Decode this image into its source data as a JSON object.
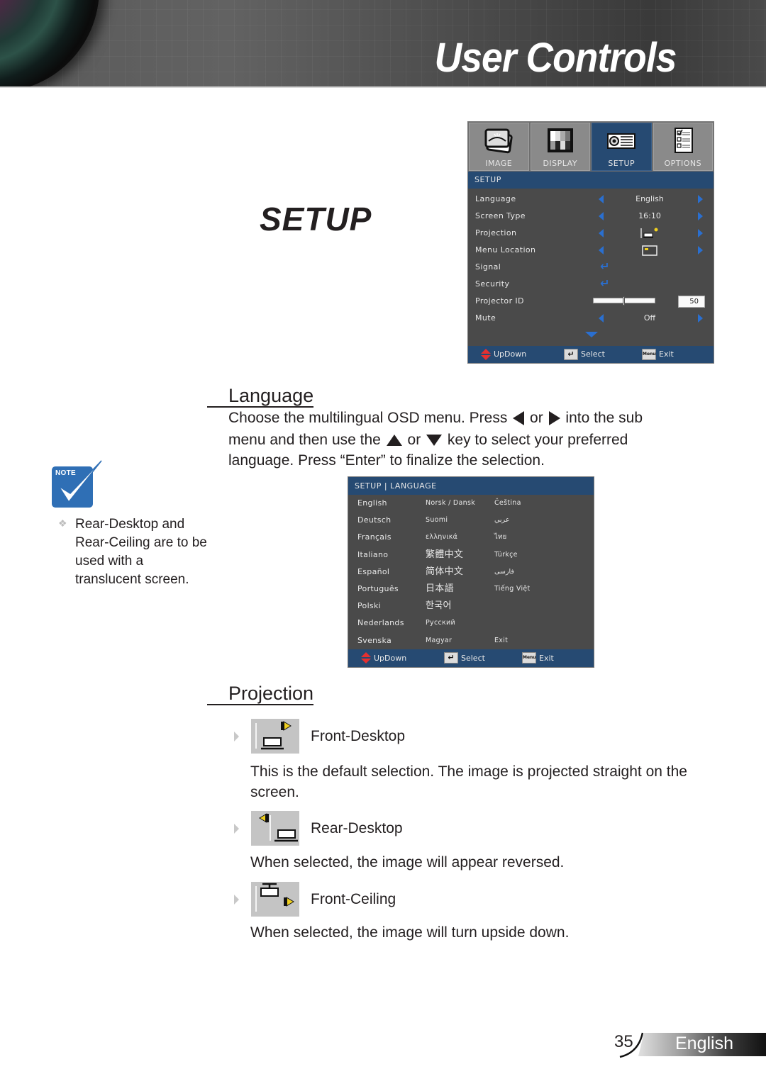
{
  "header": {
    "title": "User Controls"
  },
  "section_title": "SETUP",
  "osd_menu": {
    "tabs": [
      {
        "label": "IMAGE",
        "icon": "image-icon",
        "active": false
      },
      {
        "label": "DISPLAY",
        "icon": "display-icon",
        "active": false
      },
      {
        "label": "SETUP",
        "icon": "projector-icon",
        "active": true
      },
      {
        "label": "OPTIONS",
        "icon": "options-icon",
        "active": false
      }
    ],
    "section_label": "SETUP",
    "rows": [
      {
        "label": "Language",
        "value": "English",
        "control": "arrows"
      },
      {
        "label": "Screen Type",
        "value": "16:10",
        "control": "arrows"
      },
      {
        "label": "Projection",
        "value_icon": "front-desktop-icon",
        "control": "arrows"
      },
      {
        "label": "Menu Location",
        "value_icon": "menu-location-icon",
        "control": "arrows"
      },
      {
        "label": "Signal",
        "control": "enter"
      },
      {
        "label": "Security",
        "control": "enter"
      },
      {
        "label": "Projector ID",
        "value": "50",
        "control": "slider",
        "slider_fraction": 0.5
      },
      {
        "label": "Mute",
        "value": "Off",
        "control": "arrows"
      }
    ],
    "footer": {
      "updown": "UpDown",
      "select": "Select",
      "exit": "Exit",
      "enter_key": "↵",
      "menu_key": "Menu"
    },
    "colors": {
      "accent": "#264a72",
      "arrow": "#2a6fd0",
      "background": "#4a4a4a"
    }
  },
  "language_section": {
    "heading": "Language",
    "para_part1": "Choose the multilingual OSD menu. Press",
    "para_or1": "or",
    "para_part2": "into the sub",
    "para_line2a": "menu and then use the",
    "para_or2": "or",
    "para_line2b": "key to select your preferred",
    "para_line3": "language. Press “Enter” to finalize the selection."
  },
  "language_menu": {
    "header": "SETUP | LANGUAGE",
    "rows": [
      [
        "English",
        "Norsk / Dansk",
        "Čeština"
      ],
      [
        "Deutsch",
        "Suomi",
        "عربي"
      ],
      [
        "Français",
        "ελληνικά",
        "ไทย"
      ],
      [
        "Italiano",
        "繁體中文",
        "Türkçe"
      ],
      [
        "Español",
        "简体中文",
        "فارسی"
      ],
      [
        "Português",
        "日本語",
        "Tiếng Việt"
      ],
      [
        "Polski",
        "한국어",
        ""
      ],
      [
        "Nederlands",
        "Русский",
        ""
      ],
      [
        "Svenska",
        "Magyar",
        "Exit"
      ]
    ],
    "footer": {
      "updown": "UpDown",
      "select": "Select",
      "exit": "Exit",
      "enter_key": "↵",
      "menu_key": "Menu"
    }
  },
  "note": {
    "badge": "NOTE",
    "bullet": "❖",
    "text": "Rear-Desktop and Rear-Ceiling are to be used with a translucent screen."
  },
  "projection_section": {
    "heading": "Projection",
    "options": [
      {
        "label": "Front-Desktop",
        "icon": "front-desktop-icon",
        "description": "This is the default selection. The image is projected straight on the screen."
      },
      {
        "label": "Rear-Desktop",
        "icon": "rear-desktop-icon",
        "description": "When selected, the image will appear reversed."
      },
      {
        "label": "Front-Ceiling",
        "icon": "front-ceiling-icon",
        "description": "When selected, the image will turn upside down."
      }
    ]
  },
  "footer": {
    "page_number": "35",
    "language": "English"
  }
}
